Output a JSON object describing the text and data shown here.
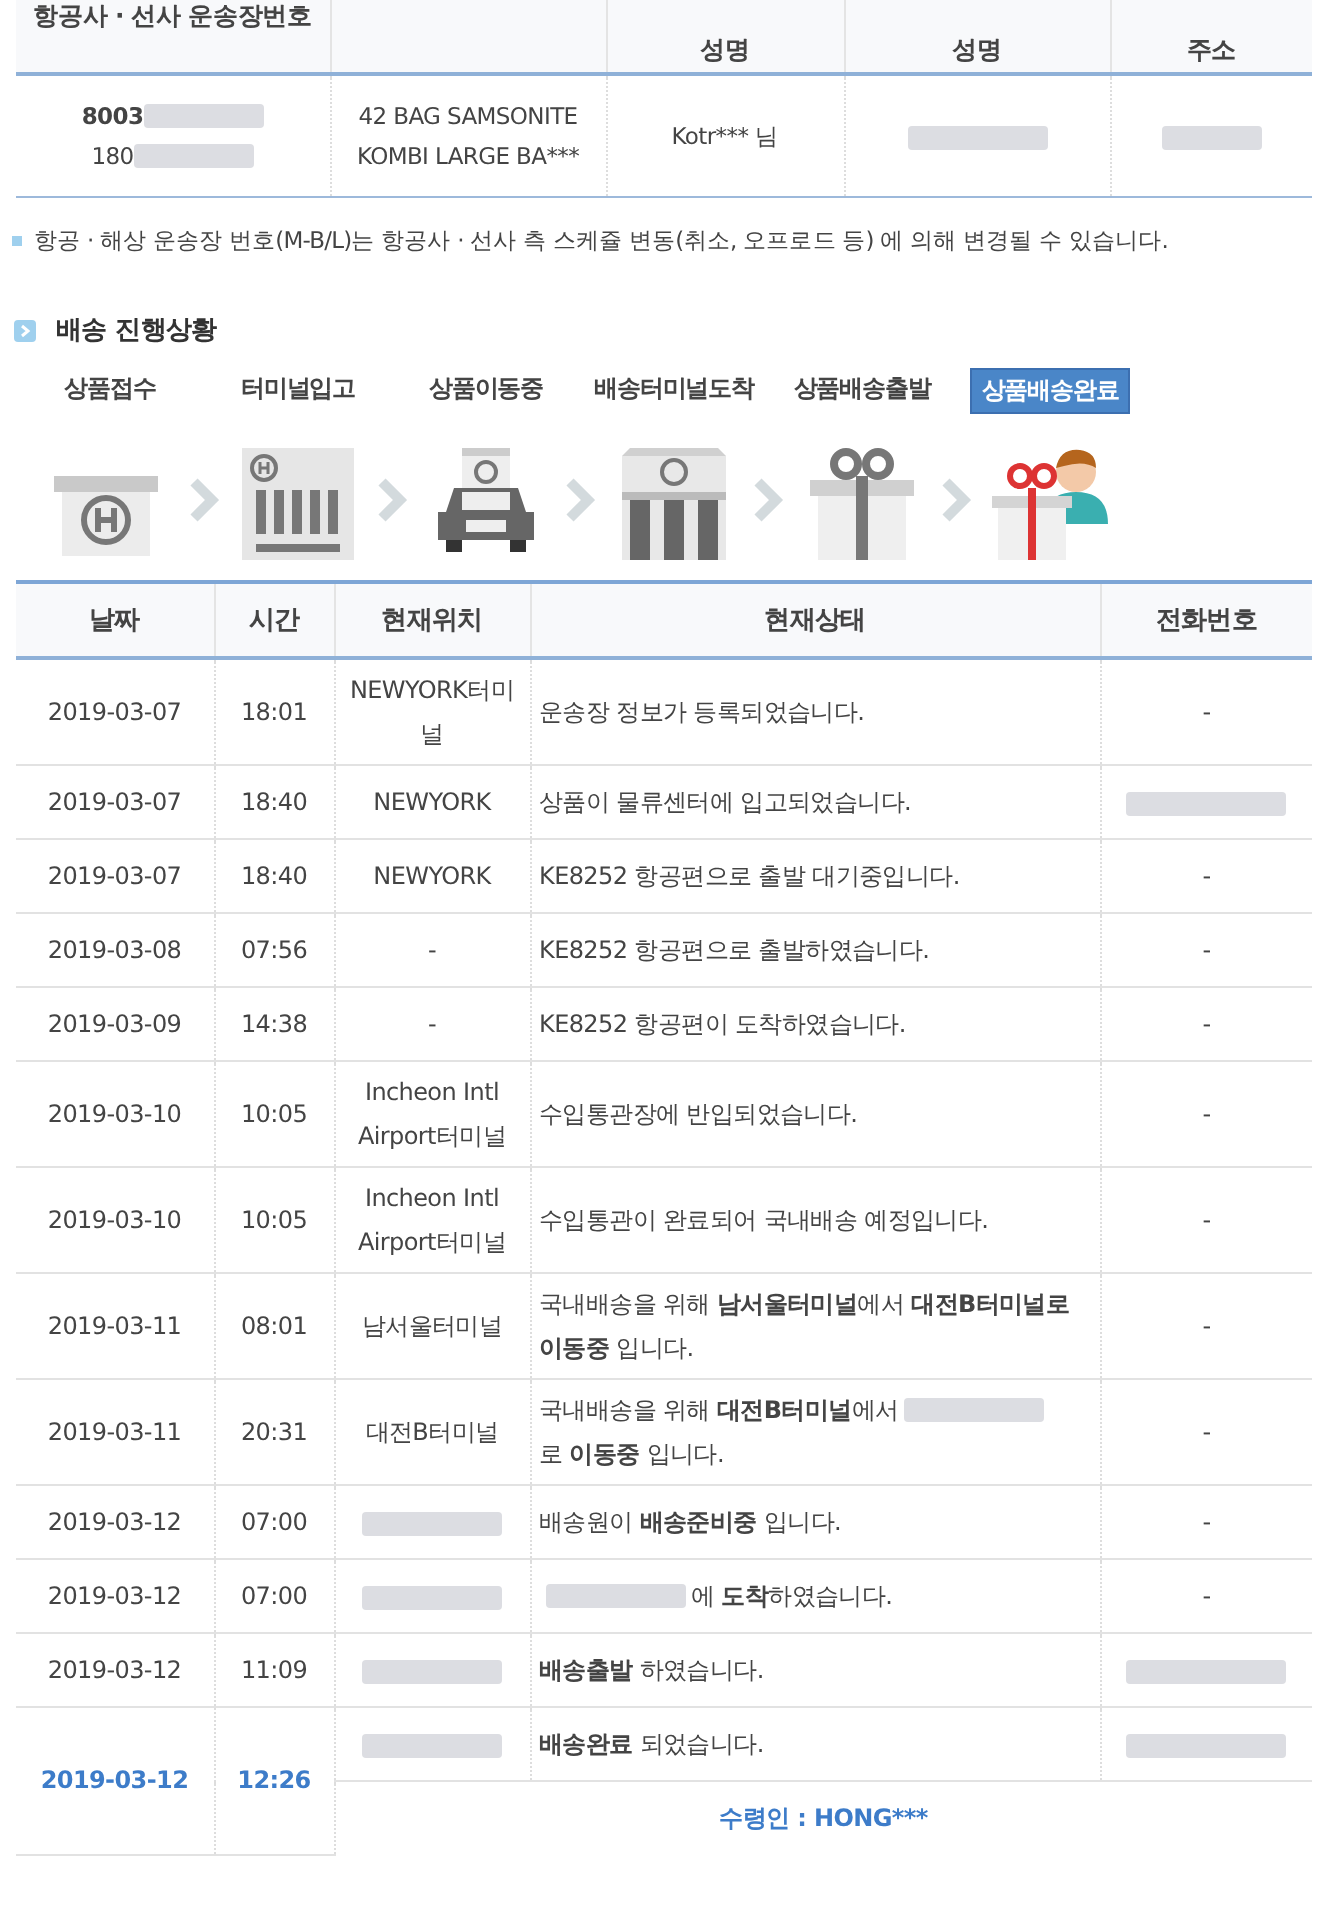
{
  "waybill_table": {
    "columns": [
      "항공사 · 선사 운송장번호",
      "",
      "성명",
      "성명",
      "주소"
    ],
    "row": {
      "waybill_lines": [
        {
          "text": "8003",
          "bold": true,
          "redacted": true
        },
        {
          "text": "180",
          "bold": false,
          "redacted": true
        }
      ],
      "item": "42 BAG SAMSONITE KOMBI LARGE BA***",
      "sender": "Kotr*** 님",
      "receiver_redacted": true,
      "address_redacted": true
    }
  },
  "note": "항공 · 해상 운송장 번호(M-B/L)는 항공사 · 선사 측 스케쥴 변동(취소, 오프로드 등) 에 의해 변경될 수 있습니다.",
  "section_title": "배송 진행상황",
  "steps": [
    {
      "label": "상품접수",
      "kind": "box",
      "selected": false
    },
    {
      "label": "터미널입고",
      "kind": "terminal",
      "selected": false
    },
    {
      "label": "상품이동중",
      "kind": "truck",
      "selected": false
    },
    {
      "label": "배송터미널도착",
      "kind": "building",
      "selected": false
    },
    {
      "label": "상품배송출발",
      "kind": "gift",
      "selected": false
    },
    {
      "label": "상품배송완료",
      "kind": "person",
      "selected": true
    }
  ],
  "tracking_table": {
    "columns": [
      "날짜",
      "시간",
      "현재위치",
      "현재상태",
      "전화번호"
    ],
    "rows": [
      {
        "date": "2019-03-07",
        "time": "18:01",
        "location": "NEWYORK터미널",
        "status": [
          {
            "kind": "text",
            "text": "운송장 정보가 등록되었습니다."
          }
        ],
        "phone": "-",
        "highlighted": false
      },
      {
        "date": "2019-03-07",
        "time": "18:40",
        "location": "NEWYORK",
        "status": [
          {
            "kind": "text",
            "text": "상품이 물류센터에 입고되었습니다."
          }
        ],
        "phone_redacted": true,
        "highlighted": false
      },
      {
        "date": "2019-03-07",
        "time": "18:40",
        "location": "NEWYORK",
        "status": [
          {
            "kind": "text",
            "text": "KE8252 항공편으로 출발 대기중입니다."
          }
        ],
        "phone": "-",
        "highlighted": false
      },
      {
        "date": "2019-03-08",
        "time": "07:56",
        "location": "-",
        "status": [
          {
            "kind": "text",
            "text": "KE8252 항공편으로 출발하였습니다."
          }
        ],
        "phone": "-",
        "highlighted": false
      },
      {
        "date": "2019-03-09",
        "time": "14:38",
        "location": "-",
        "status": [
          {
            "kind": "text",
            "text": "KE8252 항공편이 도착하였습니다."
          }
        ],
        "phone": "-",
        "highlighted": false
      },
      {
        "date": "2019-03-10",
        "time": "10:05",
        "location": "Incheon Intl Airport터미널",
        "status": [
          {
            "kind": "text",
            "text": "수입통관장에 반입되었습니다."
          }
        ],
        "phone": "-",
        "highlighted": false
      },
      {
        "date": "2019-03-10",
        "time": "10:05",
        "location": "Incheon Intl Airport터미널",
        "status": [
          {
            "kind": "text",
            "text": "수입통관이 완료되어 국내배송 예정입니다."
          }
        ],
        "phone": "-",
        "highlighted": false
      },
      {
        "date": "2019-03-11",
        "time": "08:01",
        "location": "남서울터미널",
        "status": [
          {
            "kind": "text",
            "text": "국내배송을 위해 **남서울터미널**에서 **대전B터미널로 이동중** 입니다."
          }
        ],
        "phone": "-",
        "highlighted": false
      },
      {
        "date": "2019-03-11",
        "time": "20:31",
        "location": "대전B터미널",
        "status": [
          {
            "kind": "text",
            "text": "국내배송을 위해 **대전B터미널**에서"
          },
          {
            "kind": "redacted"
          },
          {
            "kind": "text",
            "text": "로 **이동중** 입니다."
          }
        ],
        "phone": "-",
        "highlighted": false
      },
      {
        "date": "2019-03-12",
        "time": "07:00",
        "location_redacted": true,
        "status": [
          {
            "kind": "text",
            "text": "배송원이 **배송준비중** 입니다."
          }
        ],
        "phone": "-",
        "highlighted": false
      },
      {
        "date": "2019-03-12",
        "time": "07:00",
        "location_redacted": true,
        "status": [
          {
            "kind": "redacted"
          },
          {
            "kind": "text",
            "text": "에 **도착**하였습니다."
          }
        ],
        "phone": "-",
        "highlighted": false
      },
      {
        "date": "2019-03-12",
        "time": "11:09",
        "location_redacted": true,
        "status": [
          {
            "kind": "text",
            "text": "**배송출발** 하였습니다."
          }
        ],
        "phone_redacted": true,
        "highlighted": false
      },
      {
        "date": "2019-03-12",
        "time": "12:26",
        "location_redacted": true,
        "status": [
          {
            "kind": "text",
            "text": "**배송완료** 되었습니다."
          }
        ],
        "phone_redacted": true,
        "highlighted": true,
        "receiver": "수령인 : HONG***"
      }
    ]
  }
}
